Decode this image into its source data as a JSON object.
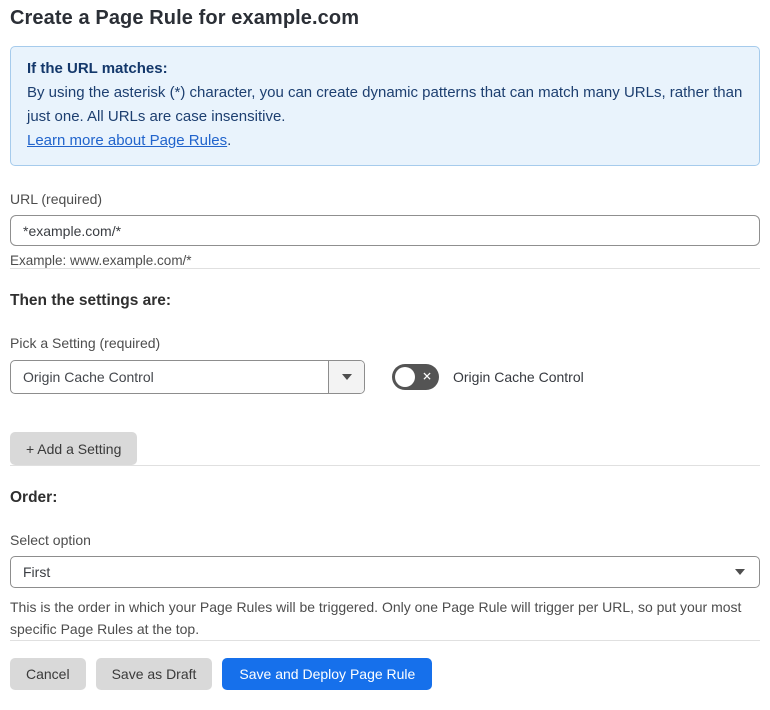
{
  "page": {
    "title": "Create a Page Rule for example.com"
  },
  "info_box": {
    "heading": "If the URL matches:",
    "body": "By using the asterisk (*) character, you can create dynamic patterns that can match many URLs, rather than just one. All URLs are case insensitive.",
    "link": "Learn more about Page Rules",
    "link_suffix": "."
  },
  "url_field": {
    "label": "URL (required)",
    "value": "*example.com/*",
    "helper": "Example: www.example.com/*"
  },
  "settings_section": {
    "heading": "Then the settings are:",
    "picker_label": "Pick a Setting (required)",
    "picker_value": "Origin Cache Control",
    "toggle_label": "Origin Cache Control",
    "toggle_state": "off",
    "add_button_label": "+ Add a Setting"
  },
  "order_section": {
    "heading": "Order:",
    "select_label": "Select option",
    "select_value": "First",
    "helper": "This is the order in which your Page Rules will be triggered. Only one Page Rule will trigger per URL, so put your most specific Page Rules at the top."
  },
  "footer": {
    "cancel_label": "Cancel",
    "save_draft_label": "Save as Draft",
    "save_deploy_label": "Save and Deploy Page Rule"
  },
  "colors": {
    "primary_blue": "#1670eb",
    "info_background": "#e9f3fc",
    "info_border": "#a6cbec",
    "info_text": "#1d3f70",
    "link_blue": "#2164cc",
    "toggle_off_gray": "#545454",
    "button_gray": "#d9d9d9"
  }
}
